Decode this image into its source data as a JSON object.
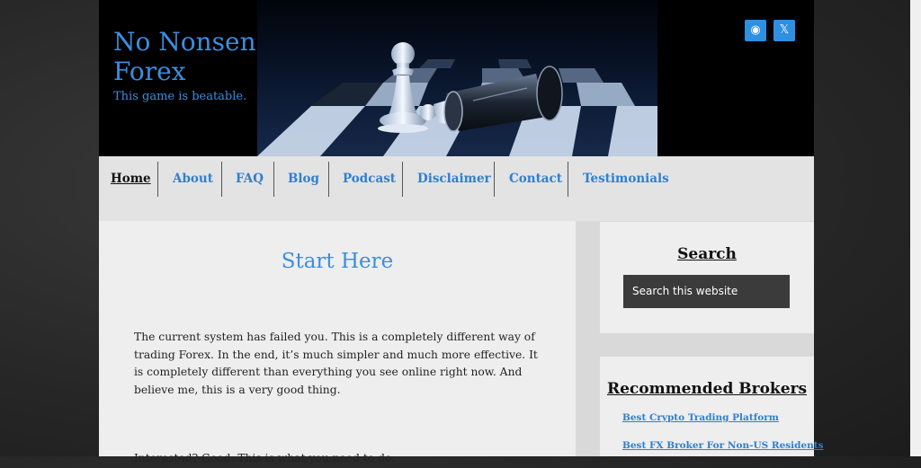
{
  "site": {
    "title": "No Nonsense Forex",
    "tagline": "This game is beatable."
  },
  "social": {
    "rss_icon": "rss-icon",
    "x_icon": "x-icon",
    "rss_glyph": "◉",
    "x_glyph": "𝕏"
  },
  "nav": {
    "items": [
      {
        "label": "Home",
        "active": true
      },
      {
        "label": "About"
      },
      {
        "label": "FAQ"
      },
      {
        "label": "Blog"
      },
      {
        "label": "Podcast"
      },
      {
        "label": "Disclaimer"
      },
      {
        "label": "Contact"
      },
      {
        "label": "Testimonials"
      }
    ]
  },
  "main": {
    "title": "Start Here",
    "paragraph": "The current system has failed you.  This is a completely different way of trading Forex.  In the end, it’s much simpler and much more effective.  It is completely different than everything you see online right now.  And believe me, this is a very good thing.",
    "paragraph2": "Interested?  Good.  This is what you need to do."
  },
  "sidebar": {
    "search": {
      "title": "Search",
      "placeholder": "Search this website"
    },
    "brokers": {
      "title": "Recommended Brokers",
      "links": [
        "Best Crypto Trading Platform",
        "Best FX Broker For Non-US Residents"
      ]
    }
  },
  "colors": {
    "accent": "#3a8ee0",
    "link": "#2f7fd0",
    "header_bg": "#000000"
  }
}
